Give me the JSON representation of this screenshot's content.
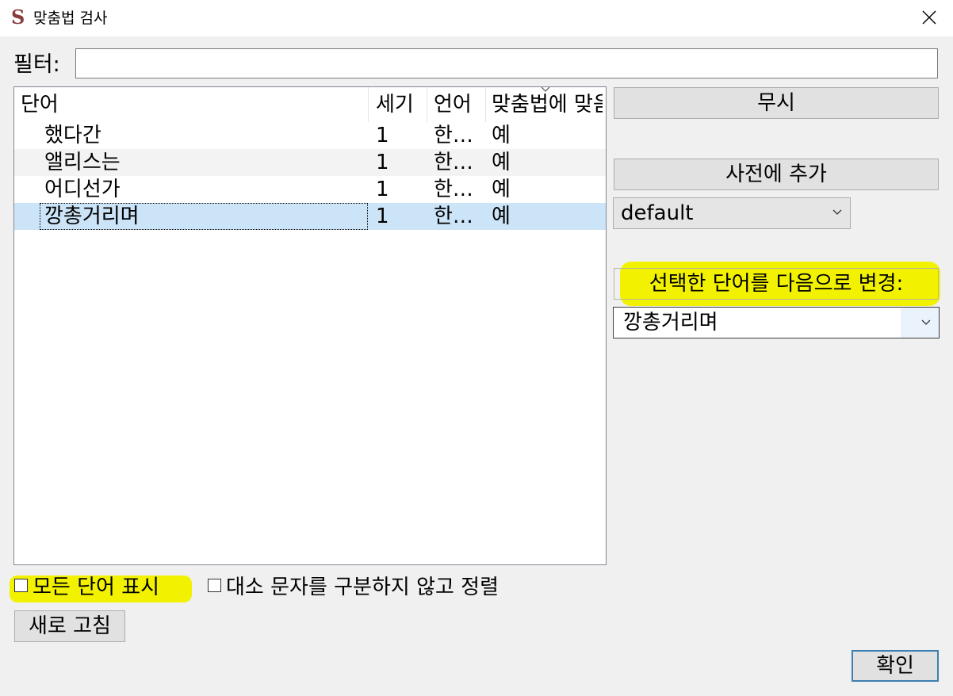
{
  "window": {
    "title": "맞춤법 검사",
    "app_icon": "S"
  },
  "filter": {
    "label": "필터:",
    "value": ""
  },
  "list": {
    "columns": [
      "단어",
      "세기",
      "언어",
      "맞춤법에 맞음"
    ],
    "rows": [
      {
        "word": "했다간",
        "count": "1",
        "lang": "한…",
        "correct": "예"
      },
      {
        "word": "앨리스는",
        "count": "1",
        "lang": "한…",
        "correct": "예"
      },
      {
        "word": "어디선가",
        "count": "1",
        "lang": "한…",
        "correct": "예"
      },
      {
        "word": "깡총거리며",
        "count": "1",
        "lang": "한…",
        "correct": "예"
      }
    ],
    "selected_index": 3
  },
  "buttons": {
    "ignore": "무시",
    "add_to_dict": "사전에 추가",
    "change_to": "선택한 단어를 다음으로 변경:",
    "refresh": "새로 고침",
    "ok": "확인"
  },
  "dictionary_select": {
    "value": "default"
  },
  "replacement_select": {
    "value": "깡총거리며"
  },
  "options": {
    "show_all_words": "모든 단어 표시",
    "case_insensitive_sort": "대소 문자를 구분하지 않고 정렬"
  },
  "colors": {
    "highlight": "#f2f200",
    "selection": "#cce4f7",
    "focus_border": "#3c7fb1"
  }
}
